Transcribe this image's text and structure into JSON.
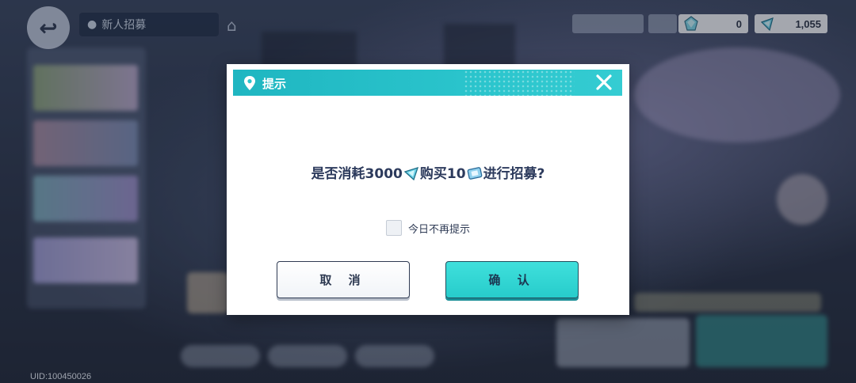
{
  "background": {
    "title": "新人招募",
    "uid": "UID:100450026"
  },
  "currency": [
    {
      "icon": "crystal-icon",
      "value": "0"
    },
    {
      "icon": "diamond-icon",
      "value": "1,055"
    }
  ],
  "dialog": {
    "title": "提示",
    "message_part1": "是否消耗3000",
    "message_part2": "购买10",
    "message_part3": "进行招募?",
    "checkbox_label": "今日不再提示",
    "cancel_label": "取 消",
    "confirm_label": "确 认"
  },
  "colors": {
    "header_teal": "#2ac4cc",
    "confirm_button": "#2fd5d3",
    "text_dark": "#2c3a5c"
  }
}
